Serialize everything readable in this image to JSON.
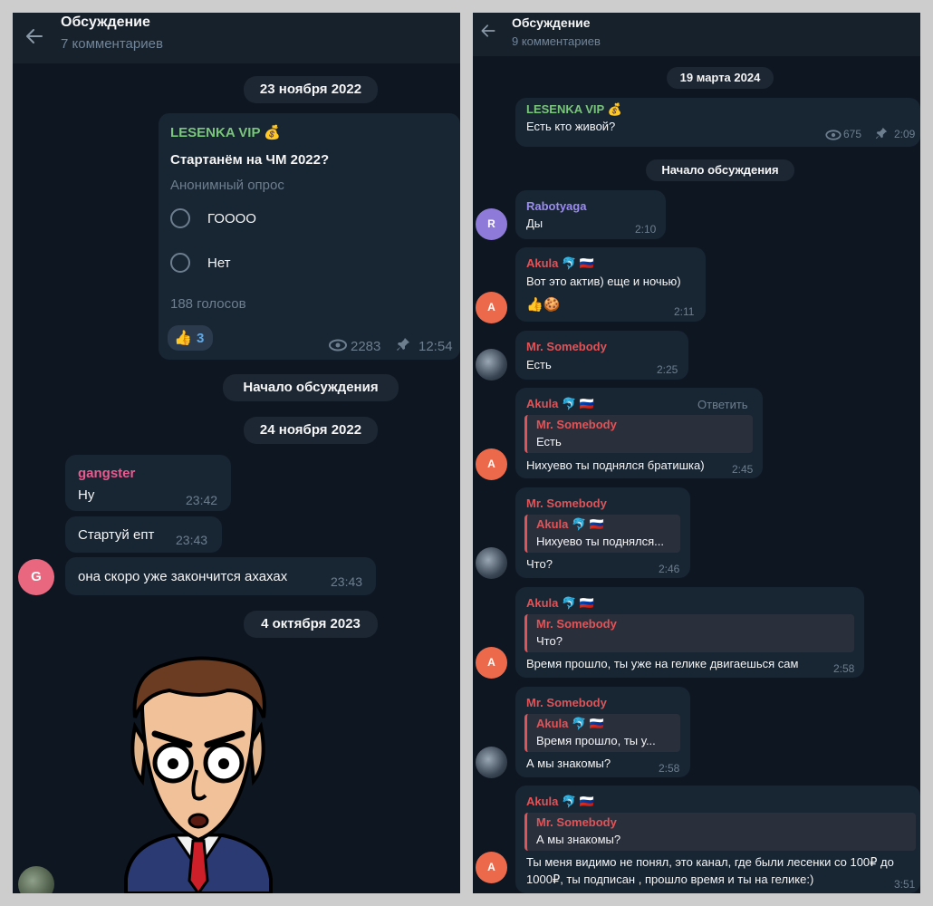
{
  "left": {
    "header": {
      "title": "Обсуждение",
      "subtitle": "7 комментариев"
    },
    "date1": "23 ноября 2022",
    "post": {
      "author": "LESENKA VIP 💰",
      "question": "Стартанём на ЧМ 2022?",
      "poll_type": "Анонимный опрос",
      "options": [
        "ГОООО",
        "Нет"
      ],
      "votes": "188 голосов",
      "reaction_emoji": "👍",
      "reaction_count": "3",
      "views": "2283",
      "time": "12:54"
    },
    "discussion_start": "Начало обсуждения",
    "date2": "24 ноября 2022",
    "messages": [
      {
        "author": "gangster",
        "text": "Ну",
        "time": "23:42"
      },
      {
        "text": "Стартуй епт",
        "time": "23:43"
      },
      {
        "text": "она скоро уже закончится ахахах",
        "time": "23:43"
      }
    ],
    "avatar_letter": "G",
    "date3": "4 октября 2023"
  },
  "right": {
    "header": {
      "title": "Обсуждение",
      "subtitle": "9 комментариев"
    },
    "date": "19 марта 2024",
    "post": {
      "author": "LESENKA VIP 💰",
      "text": "Есть кто живой?",
      "views": "675",
      "time": "2:09"
    },
    "discussion_start": "Начало обсуждения",
    "messages": [
      {
        "author": "Rabotyaga",
        "text": "Ды",
        "time": "2:10",
        "avatar": "R"
      },
      {
        "author": "Akula 🐬 🇷🇺",
        "text": "Вот это актив) еще и ночью)",
        "reactions": "👍🍪",
        "time": "2:11",
        "avatar": "A"
      },
      {
        "author": "Mr. Somebody",
        "text": "Есть",
        "time": "2:25"
      },
      {
        "author": "Akula 🐬 🇷🇺",
        "reply_label": "Ответить",
        "reply_author": "Mr. Somebody",
        "reply_text": "Есть",
        "text": "Нихуево ты поднялся братишка)",
        "time": "2:45",
        "avatar": "A"
      },
      {
        "author": "Mr. Somebody",
        "reply_author": "Akula 🐬 🇷🇺",
        "reply_text": "Нихуево ты поднялся...",
        "text": "Что?",
        "time": "2:46"
      },
      {
        "author": "Akula 🐬 🇷🇺",
        "reply_author": "Mr. Somebody",
        "reply_text": "Что?",
        "text": "Время прошло, ты уже на гелике двигаешься сам",
        "time": "2:58",
        "avatar": "A"
      },
      {
        "author": "Mr. Somebody",
        "reply_author": "Akula 🐬 🇷🇺",
        "reply_text": "Время прошло, ты у...",
        "text": "А мы знакомы?",
        "time": "2:58"
      },
      {
        "author": "Akula 🐬 🇷🇺",
        "reply_author": "Mr. Somebody",
        "reply_text": "А мы знакомы?",
        "text_line1": "Ты меня видимо не понял, это канал, где были лесенки со 100₽ до",
        "text_line2": "1000₽, ты подписан , прошло время и ты на гелике:)",
        "time": "3:51",
        "avatar": "A"
      }
    ]
  },
  "colors": {
    "panel_bg": "#0e1621",
    "header_bg": "#17212b",
    "bubble_bg": "#182533",
    "channel_name": "#7ac67a",
    "gangster": "#e95b8f",
    "rabotyaga": "#9b8cf0",
    "akula": "#e05458",
    "somebody": "#e05458",
    "muted": "#6d7f8f"
  }
}
